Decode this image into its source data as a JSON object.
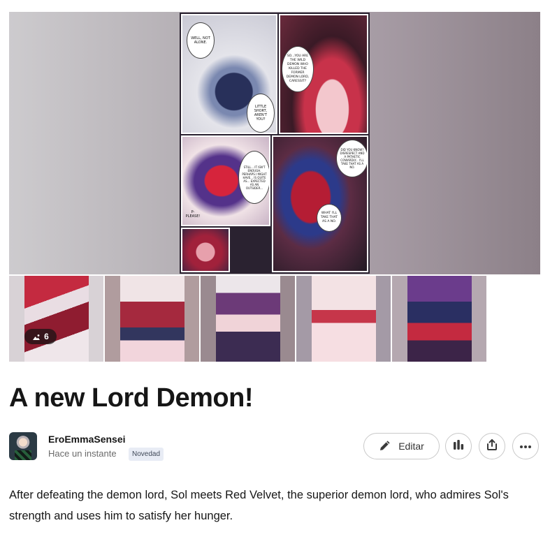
{
  "gallery": {
    "main_page_bubbles": [
      "Well, not alone.",
      "So...you are the wild demon who killed the former demon lord, Caressit?",
      "Little short, aren't you?",
      "Still... it isn't enough. Perhaps I might have... Is quite as... expected as an outsider...",
      "Did you know? Disrespect and a pathetic cowardly... I'll take that as a no.",
      "P-please!",
      "What I'll take that as a no."
    ],
    "more_count": "6",
    "thumbnail_count": 5
  },
  "post": {
    "title": "A new Lord Demon!",
    "description": "After defeating the demon lord, Sol meets Red Velvet, the superior demon lord, who admires Sol's strength and uses him to satisfy her hunger."
  },
  "author": {
    "name": "EroEmmaSensei",
    "time": "Hace un instante",
    "tag": "Novedad"
  },
  "actions": {
    "edit_label": "Editar",
    "stats_icon": "bar-chart-icon",
    "share_icon": "share-icon",
    "more_icon": "more-horizontal-icon"
  },
  "colors": {
    "text": "#161616",
    "muted": "#6b6b6b",
    "tag_bg": "#e8ecf5",
    "border": "#c9c9c9"
  }
}
